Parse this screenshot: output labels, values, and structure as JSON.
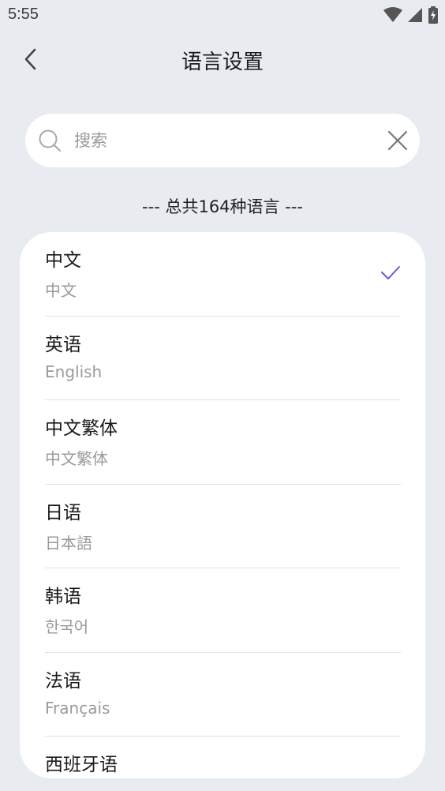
{
  "status_bar": {
    "time": "5:55"
  },
  "header": {
    "title": "语言设置"
  },
  "search": {
    "placeholder": "搜索",
    "value": ""
  },
  "total_label": "--- 总共164种语言 ---",
  "accent_color": "#6a5acd",
  "languages": [
    {
      "name": "中文",
      "native": "中文",
      "selected": true
    },
    {
      "name": "英语",
      "native": "English",
      "selected": false
    },
    {
      "name": "中文繁体",
      "native": "中文繁体",
      "selected": false
    },
    {
      "name": "日语",
      "native": "日本語",
      "selected": false
    },
    {
      "name": "韩语",
      "native": "한국어",
      "selected": false
    },
    {
      "name": "法语",
      "native": "Français",
      "selected": false
    },
    {
      "name": "西班牙语",
      "native": "",
      "selected": false
    }
  ]
}
